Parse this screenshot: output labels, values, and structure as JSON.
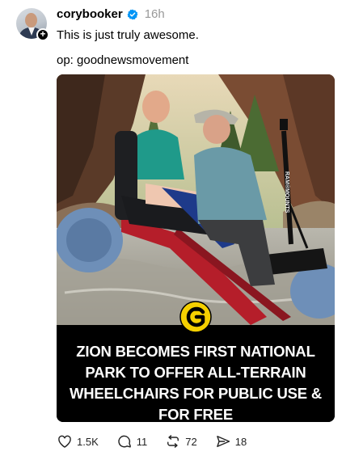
{
  "post": {
    "username": "corybooker",
    "time": "16h",
    "text": "This is just truly awesome.",
    "op": "op: goodnewsmovement"
  },
  "media": {
    "caption": "ZION BECOMES FIRST NATIONAL PARK TO OFFER ALL-TERRAIN WHEELCHAIRS FOR PUBLIC USE & FOR FREE",
    "sign_text": "RAM®MOUNTS"
  },
  "actions": {
    "likes": "1.5K",
    "replies": "11",
    "reposts": "72",
    "shares": "18"
  },
  "colors": {
    "verified": "#0095f6",
    "logo_yellow": "#f5d000",
    "wheel_blue": "#6e8fb8",
    "frame_red": "#b51e2a"
  }
}
